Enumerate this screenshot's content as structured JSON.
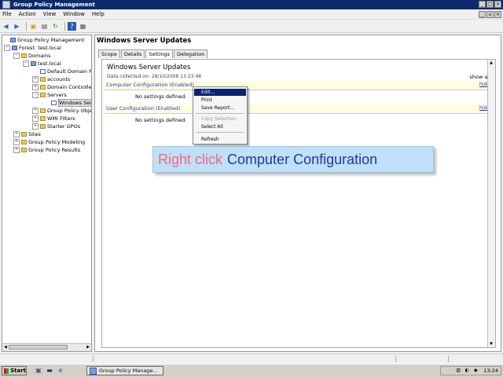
{
  "window": {
    "title": "Group Policy Management"
  },
  "menu": [
    "File",
    "Action",
    "View",
    "Window",
    "Help"
  ],
  "toolbar_icons": [
    "back-icon",
    "forward-icon",
    "up-folder-icon",
    "show-hide-tree-icon",
    "refresh-icon",
    "help-icon",
    "properties-icon"
  ],
  "tree": [
    {
      "label": "Group Policy Management",
      "expander": ""
    },
    {
      "label": "Forest: test.local",
      "expander": "−"
    },
    {
      "label": "Domains",
      "expander": "−"
    },
    {
      "label": "test.local",
      "expander": "−"
    },
    {
      "label": "Default Domain P",
      "expander": ""
    },
    {
      "label": "accounts",
      "expander": "+"
    },
    {
      "label": "Domain Controlle",
      "expander": "+"
    },
    {
      "label": "Servers",
      "expander": "−"
    },
    {
      "label": "Windows Ser",
      "expander": ""
    },
    {
      "label": "Group Policy Obje",
      "expander": "+"
    },
    {
      "label": "WMI Filters",
      "expander": "+"
    },
    {
      "label": "Starter GPOs",
      "expander": "+"
    },
    {
      "label": "Sites",
      "expander": "+"
    },
    {
      "label": "Group Policy Modeling",
      "expander": "+"
    },
    {
      "label": "Group Policy Results",
      "expander": "+"
    }
  ],
  "pane": {
    "title": "Windows Server Updates",
    "tabs": [
      "Scope",
      "Details",
      "Settings",
      "Delegation"
    ],
    "active_tab": "Settings"
  },
  "report": {
    "title": "Windows Server Updates",
    "data_collected": "Data collected on: 28/10/2008 13:23:48",
    "show_all": "show all",
    "computer_config": "Computer Configuration (Enabled)",
    "user_config": "User Configuration (Enabled)",
    "hide": "hide",
    "no_settings": "No settings defined."
  },
  "context_menu": {
    "items": [
      "Edit...",
      "Print",
      "Save Report...",
      "Copy Selection",
      "Select All",
      "Refresh"
    ],
    "highlighted": "Edit...",
    "disabled": [
      "Copy Selection"
    ]
  },
  "callout": {
    "action": "Right click",
    "target": "Computer Configuration"
  },
  "taskbar": {
    "start": "Start",
    "task": "Group Policy Manage...",
    "clock": "13:24"
  },
  "colors": {
    "titlebar": "#0d2a6c",
    "highlight": "#0a246a",
    "link": "#1a3dbd",
    "callout_bg": "#bfe0f8",
    "callout_action": "#f06a80",
    "callout_target": "#213a9b"
  }
}
